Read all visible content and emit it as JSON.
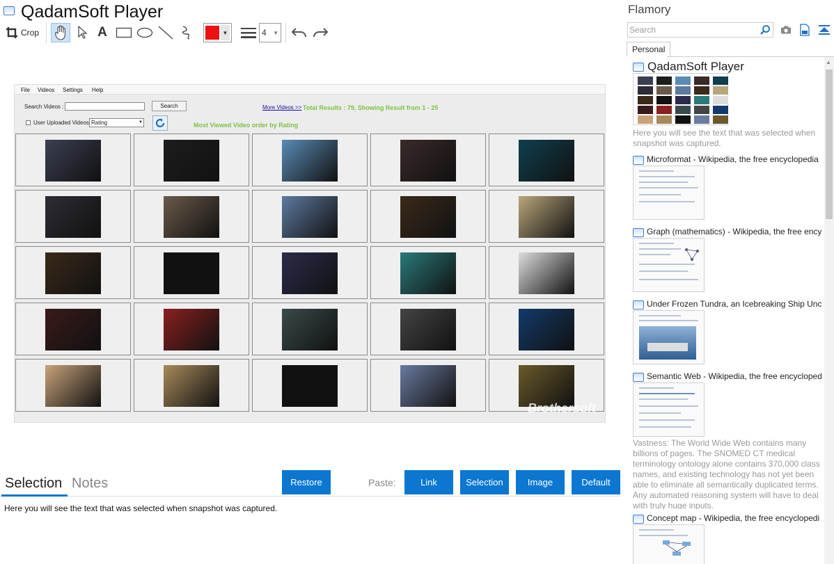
{
  "app": {
    "title": "QadamSoft Player"
  },
  "toolbar": {
    "crop_label": "Crop",
    "width_value": "4",
    "pen_color": "#ee1111",
    "icons": [
      "crop-icon",
      "hand-icon",
      "pointer-icon",
      "text-icon",
      "rectangle-icon",
      "ellipse-icon",
      "line-icon",
      "freehand-icon",
      "color-picker",
      "line-width-icon",
      "undo-icon",
      "redo-icon"
    ]
  },
  "screenshot": {
    "menu": [
      "File",
      "Videos",
      "Settings",
      "Help"
    ],
    "search_label": "Search Videos :",
    "search_button": "Search",
    "more_videos": "More Videos >>",
    "total_results": "Total Results : 79, Showing Result from 1 - 25",
    "checkbox_label": "User Uploaded Videos",
    "sort_value": "Rating",
    "heading": "Most Viewed Video order by Rating",
    "watermark": "Brothersoft"
  },
  "bottom": {
    "tab_selection": "Selection",
    "tab_notes": "Notes",
    "restore": "Restore",
    "paste_label": "Paste:",
    "paste_link": "Link",
    "paste_selection": "Selection",
    "paste_image": "Image",
    "paste_default": "Default",
    "selection_text": "Here you will see the text that was selected when snapshot was captured."
  },
  "sidebar": {
    "title": "Flamory",
    "search_placeholder": "Search",
    "tab": "Personal",
    "entries": [
      {
        "title": "QadamSoft Player",
        "text": "Here you will see the text that was selected when snapshot was captured."
      },
      {
        "title": "Microformat - Wikipedia, the free encyclopedia"
      },
      {
        "title": "Graph (mathematics) - Wikipedia, the free ency"
      },
      {
        "title": "Under Frozen Tundra, an Icebreaking Ship Unco"
      },
      {
        "title": "Semantic Web - Wikipedia, the free encycloped",
        "text": "Vastness: The World Wide Web contains many billions of pages. The SNOMED CT medical terminology ontology alone contains 370,000 class names, and existing technology has not yet been able to eliminate all semantically duplicated terms. Any automated reasoning system will have to deal with truly huge inputs."
      },
      {
        "title": "Concept map - Wikipedia, the free encyclopedi"
      }
    ]
  },
  "colors": {
    "accent": "#0b77d0",
    "results_green": "#7cc242",
    "link_blue": "#1a0dab"
  }
}
